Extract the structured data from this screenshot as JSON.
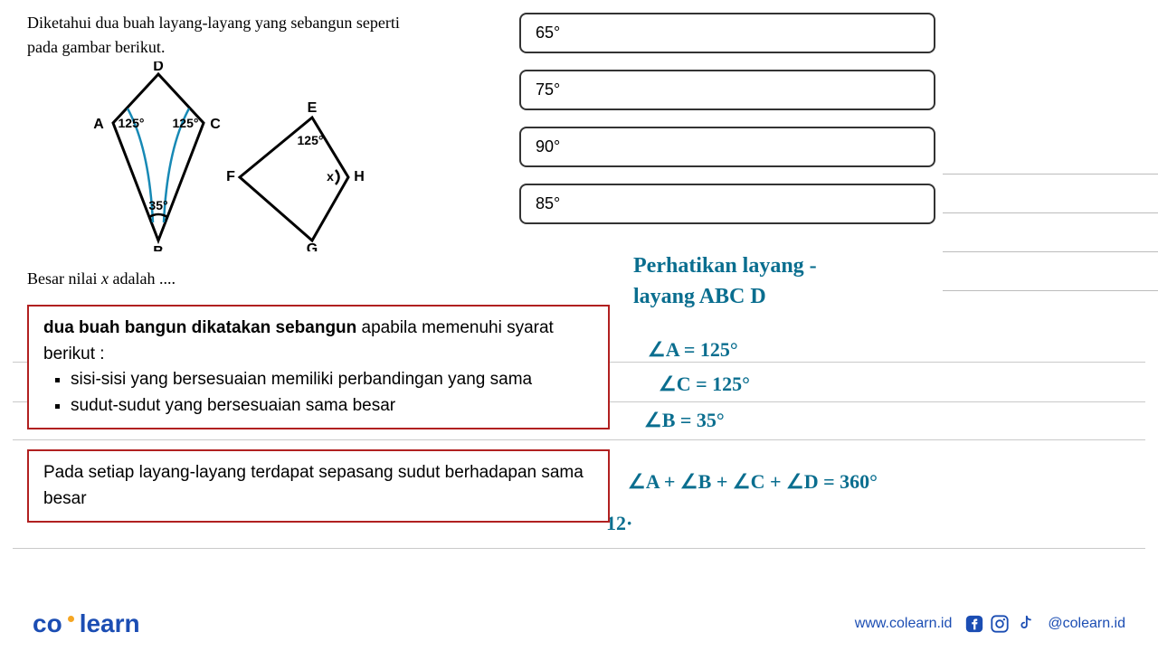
{
  "problem": {
    "text_line1": "Diketahui dua buah layang-layang yang sebangun seperti",
    "text_line2": "pada gambar berikut.",
    "labels": {
      "A": "A",
      "B": "B",
      "C": "C",
      "D": "D",
      "E": "E",
      "F": "F",
      "G": "G",
      "H": "H",
      "a1": "125°",
      "a2": "125°",
      "b": "35°",
      "e": "125°",
      "x": "x"
    },
    "prompt": "Besar nilai x adalah ...."
  },
  "options": {
    "o1": "65°",
    "o2": "75°",
    "o3": "90°",
    "o4": "85°"
  },
  "info1": {
    "lead": "dua buah bangun dikatakan sebangun",
    "tail": " apabila memenuhi syarat berikut :",
    "b1": "sisi-sisi yang bersesuaian memiliki perbandingan yang sama",
    "b2": "sudut-sudut yang bersesuaian sama besar"
  },
  "info2": {
    "text": "Pada setiap layang-layang terdapat sepasang sudut berhadapan sama besar"
  },
  "handwriting": {
    "header1": "Perhatikan  layang -",
    "header2": "layang    ABC D",
    "a": "∠A = 125°",
    "c": "∠C = 125°",
    "b": "∠B = 35°",
    "eq": "∠A + ∠B + ∠C + ∠D  = 360°",
    "partial": "12·"
  },
  "footer": {
    "brand_co": "co",
    "brand_learn": "learn",
    "url": "www.colearn.id",
    "handle": "@colearn.id"
  }
}
